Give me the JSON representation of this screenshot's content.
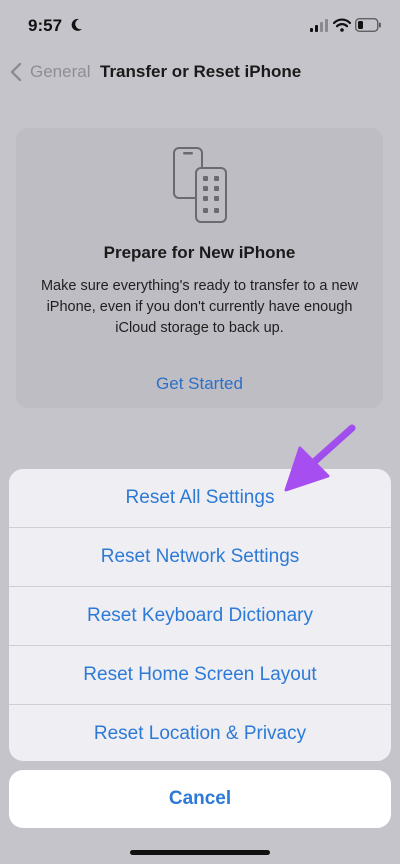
{
  "status_bar": {
    "time": "9:57",
    "icons": [
      "moon-icon",
      "signal-icon",
      "wifi-icon",
      "battery-icon"
    ]
  },
  "nav": {
    "back_label": "General",
    "title": "Transfer or Reset iPhone"
  },
  "prepare_card": {
    "icon": "phones-icon",
    "title": "Prepare for New iPhone",
    "description": "Make sure everything's ready to transfer to a new iPhone, even if you don't currently have enough iCloud storage to back up.",
    "action": "Get Started"
  },
  "action_sheet": {
    "items": [
      {
        "label": "Reset All Settings"
      },
      {
        "label": "Reset Network Settings"
      },
      {
        "label": "Reset Keyboard Dictionary"
      },
      {
        "label": "Reset Home Screen Layout"
      },
      {
        "label": "Reset Location & Privacy"
      }
    ],
    "cancel_label": "Cancel"
  },
  "colors": {
    "accent": "#2c7ad6",
    "dimmed_background": "#c5c4cb",
    "sheet_background": "#efeef3",
    "annotation_arrow": "#a64ef0"
  }
}
